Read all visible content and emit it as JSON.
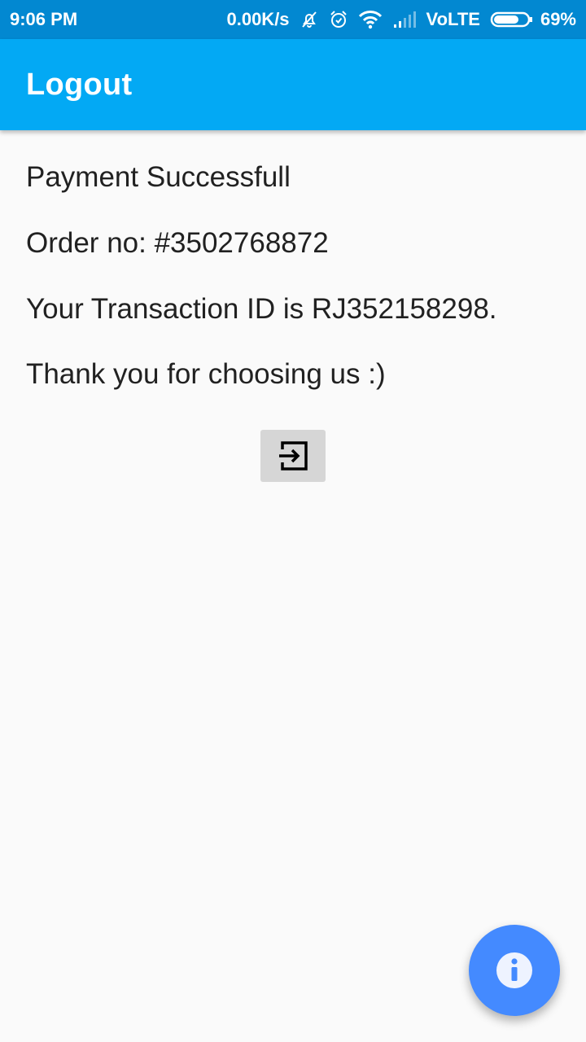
{
  "status_bar": {
    "time": "9:06 PM",
    "network_speed": "0.00K/s",
    "network_type": "VoLTE",
    "battery": "69%",
    "icons": [
      "muted-notification-icon",
      "alarm-icon",
      "wifi-icon",
      "signal-icon",
      "battery-icon"
    ]
  },
  "app_bar": {
    "title": "Logout"
  },
  "content": {
    "line1": "Payment Successfull",
    "line2": "Order no: #3502768872",
    "line3": "Your Transaction ID is RJ352158298.",
    "line4": "Thank you for choosing us :)"
  },
  "buttons": {
    "exit_icon": "exit-to-app-icon",
    "fab_icon": "info-icon"
  },
  "colors": {
    "status_bar": "#0288d1",
    "app_bar": "#03a9f4",
    "fab": "#448aff",
    "background": "#fafafa"
  }
}
